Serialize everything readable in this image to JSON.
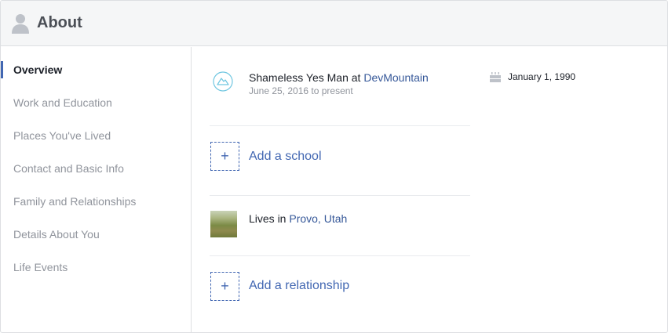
{
  "header": {
    "title": "About",
    "icon": "person-icon"
  },
  "sidebar": {
    "items": [
      {
        "label": "Overview",
        "active": true
      },
      {
        "label": "Work and Education"
      },
      {
        "label": "Places You've Lived"
      },
      {
        "label": "Contact and Basic Info"
      },
      {
        "label": "Family and Relationships"
      },
      {
        "label": "Details About You"
      },
      {
        "label": "Life Events"
      }
    ]
  },
  "work": {
    "icon": "mountain-badge-icon",
    "position": "Shameless Yes Man",
    "at": "at",
    "company": "DevMountain",
    "dates": "June 25, 2016 to present"
  },
  "add_school": {
    "plus": "+",
    "label": "Add a school"
  },
  "place": {
    "prefix": "Lives in",
    "city": "Provo, Utah"
  },
  "add_relationship": {
    "plus": "+",
    "label": "Add a relationship"
  },
  "birthday": {
    "icon": "cake-icon",
    "date": "January 1, 1990"
  },
  "colors": {
    "accent": "#4267b2",
    "link": "#365899",
    "muted": "#90949c",
    "header_bg": "#f5f6f7",
    "border": "#dddfe2"
  }
}
